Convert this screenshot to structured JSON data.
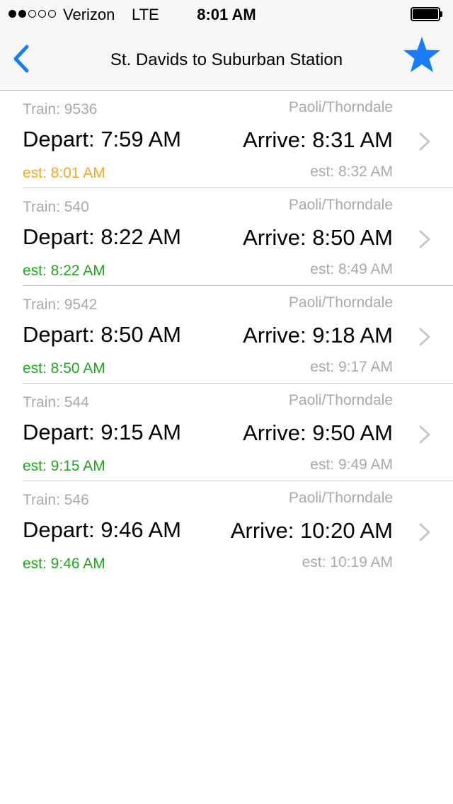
{
  "status_bar": {
    "carrier": "Verizon",
    "network": "LTE",
    "time": "8:01 AM",
    "signal_bars_filled": 2,
    "signal_bars_total": 5,
    "battery_icon": "battery-full-icon"
  },
  "nav": {
    "back_icon": "chevron-left-icon",
    "title": "St. Davids to Suburban Station",
    "favorite_icon": "star-icon",
    "accent_color": "#1a7cf5"
  },
  "colors": {
    "late": "#f5a623",
    "on_time": "#1fa81f",
    "muted": "#a9a9a9"
  },
  "trains": [
    {
      "train": "Train: 9536",
      "line": "Paoli/Thorndale",
      "depart": "Depart: 7:59 AM",
      "arrive": "Arrive: 8:31 AM",
      "est_depart": "est: 8:01 AM",
      "est_arrive": "est: 8:32 AM",
      "status": "late"
    },
    {
      "train": "Train: 540",
      "line": "Paoli/Thorndale",
      "depart": "Depart: 8:22 AM",
      "arrive": "Arrive: 8:50 AM",
      "est_depart": "est: 8:22 AM",
      "est_arrive": "est: 8:49 AM",
      "status": "on_time"
    },
    {
      "train": "Train: 9542",
      "line": "Paoli/Thorndale",
      "depart": "Depart: 8:50 AM",
      "arrive": "Arrive: 9:18 AM",
      "est_depart": "est: 8:50 AM",
      "est_arrive": "est: 9:17 AM",
      "status": "on_time"
    },
    {
      "train": "Train: 544",
      "line": "Paoli/Thorndale",
      "depart": "Depart: 9:15 AM",
      "arrive": "Arrive: 9:50 AM",
      "est_depart": "est: 9:15 AM",
      "est_arrive": "est: 9:49 AM",
      "status": "on_time"
    },
    {
      "train": "Train: 546",
      "line": "Paoli/Thorndale",
      "depart": "Depart: 9:46 AM",
      "arrive": "Arrive: 10:20 AM",
      "est_depart": "est: 9:46 AM",
      "est_arrive": "est: 10:19 AM",
      "status": "on_time"
    }
  ]
}
